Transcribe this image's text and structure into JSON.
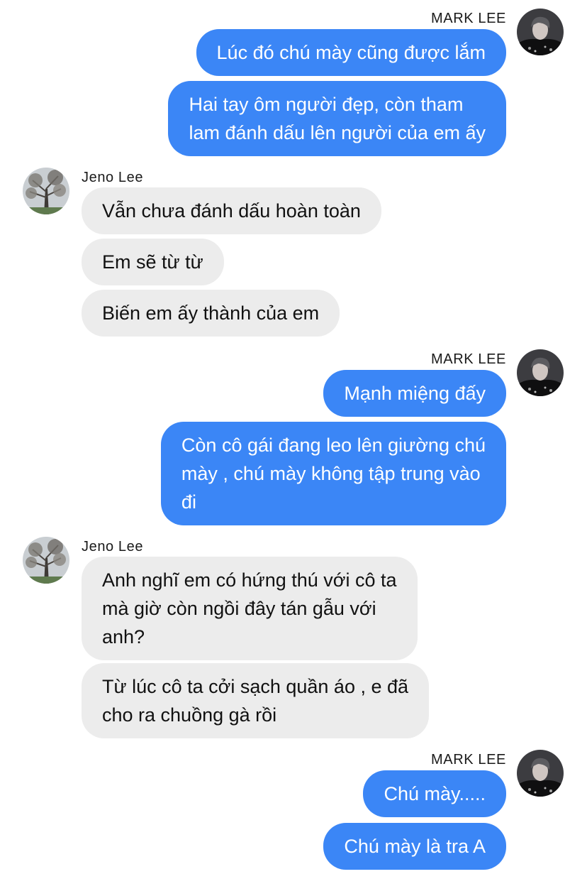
{
  "contacts": {
    "mark": {
      "name": "MARK LEE",
      "avatar": "mark-lee-avatar"
    },
    "jeno": {
      "name": "Jeno Lee",
      "avatar": "jeno-lee-avatar"
    }
  },
  "colors": {
    "sent_bubble": "#3b86f6",
    "received_bubble": "#ececec",
    "sent_text": "#ffffff",
    "received_text": "#111111"
  },
  "groups": [
    {
      "sender": "MARK LEE",
      "messages": [
        {
          "lines": [
            "Lúc đó chú mày cũng được lắm"
          ]
        },
        {
          "lines": [
            "Hai tay ôm người đẹp, còn tham",
            "lam đánh dấu lên người của em ấy"
          ]
        }
      ]
    },
    {
      "sender": "Jeno Lee",
      "messages": [
        {
          "lines": [
            "Vẫn chưa đánh dấu hoàn toàn"
          ]
        },
        {
          "lines": [
            "Em sẽ từ từ"
          ]
        },
        {
          "lines": [
            "Biến em ấy thành của em"
          ]
        }
      ]
    },
    {
      "sender": "MARK LEE",
      "messages": [
        {
          "lines": [
            "Mạnh miệng đấy"
          ]
        },
        {
          "lines": [
            "Còn cô gái đang leo lên giường chú",
            "mày , chú mày không tập trung vào",
            "đi"
          ]
        }
      ]
    },
    {
      "sender": "Jeno Lee",
      "messages": [
        {
          "lines": [
            "Anh nghĩ em có hứng thú với cô ta",
            "mà giờ còn  ngồi đây tán gẫu với",
            "anh?"
          ]
        },
        {
          "lines": [
            "Từ lúc cô ta cởi sạch quần áo , e đã",
            "cho ra chuồng gà rồi"
          ]
        }
      ]
    },
    {
      "sender": "MARK LEE",
      "messages": [
        {
          "lines": [
            "Chú mày....."
          ]
        },
        {
          "lines": [
            "Chú mày là tra A"
          ]
        }
      ]
    }
  ]
}
